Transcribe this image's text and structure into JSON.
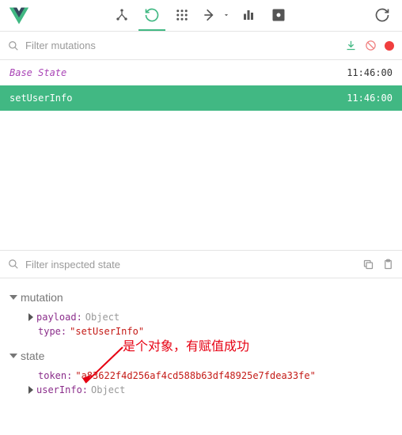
{
  "toolbar": {
    "icons": {
      "components": "components-icon",
      "vuex": "history-icon",
      "events": "events-icon",
      "routing": "routing-icon",
      "perf": "perf-icon",
      "settings": "settings-icon",
      "refresh": "refresh-icon"
    }
  },
  "filters": {
    "mutations_placeholder": "Filter mutations",
    "inspected_placeholder": "Filter inspected state"
  },
  "mutations": {
    "base_state": {
      "label": "Base State",
      "time": "11:46:00"
    },
    "selected": {
      "label": "setUserInfo",
      "time": "11:46:00"
    }
  },
  "inspect": {
    "mutation": {
      "header": "mutation",
      "payload_key": "payload:",
      "payload_val": "Object",
      "type_key": "type:",
      "type_val": "\"setUserInfo\""
    },
    "state": {
      "header": "state",
      "token_key": "token:",
      "token_val": "\"a83622f4d256af4cd588b63df48925e7fdea33fe\"",
      "userinfo_key": "userInfo:",
      "userinfo_val": "Object"
    }
  },
  "annotation": "是个对象，有赋值成功"
}
